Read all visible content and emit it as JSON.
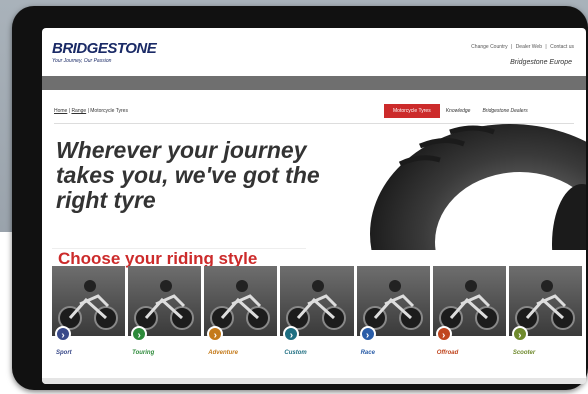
{
  "header": {
    "logo": "BRIDGESTONE",
    "tagline": "Your Journey, Our Passion",
    "utility_links": [
      "Change Country",
      "|",
      "Dealer Web",
      "|",
      "Contact us"
    ],
    "region": "Bridgestone Europe"
  },
  "nav": {
    "items": [
      "",
      "",
      "",
      "",
      ""
    ]
  },
  "breadcrumb": {
    "home": "Home",
    "sep1": "|",
    "second": "Range",
    "sep2": "|",
    "current": "Motorcycle Tyres"
  },
  "tabs": [
    {
      "label": "Motorcycle Tyres",
      "active": true
    },
    {
      "label": "Knowledge",
      "active": false
    },
    {
      "label": "Bridgestone Dealers",
      "active": false
    }
  ],
  "hero": {
    "line1": "Wherever your journey",
    "line2": "takes you, we've got the",
    "line3": "right tyre"
  },
  "riding": {
    "heading": "Choose your riding style",
    "styles": [
      {
        "label": "Sport",
        "color": "#3a4a8a",
        "icon": "arrow-icon"
      },
      {
        "label": "Touring",
        "color": "#2d8a3a",
        "icon": "arrow-icon"
      },
      {
        "label": "Adventure",
        "color": "#c47a1a",
        "icon": "arrow-icon"
      },
      {
        "label": "Custom",
        "color": "#1f6f82",
        "icon": "arrow-icon"
      },
      {
        "label": "Race",
        "color": "#2a5da8",
        "icon": "arrow-icon"
      },
      {
        "label": "Offroad",
        "color": "#c0461f",
        "icon": "arrow-icon"
      },
      {
        "label": "Scooter",
        "color": "#6f8a2d",
        "icon": "arrow-icon"
      }
    ]
  },
  "colors": {
    "accent": "#cc2b2b",
    "brand": "#1a2a66",
    "nav": "#6f6f6f"
  }
}
